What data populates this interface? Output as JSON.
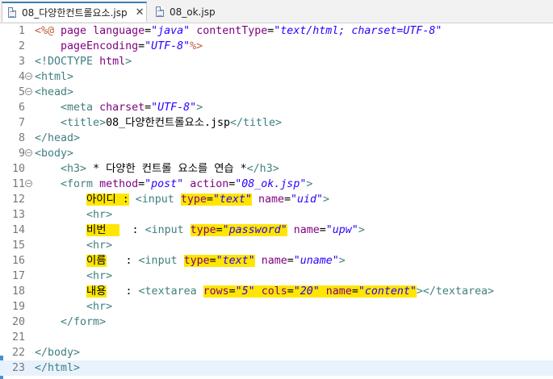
{
  "tabs": [
    {
      "label": "08_다양한컨트롤요소.jsp",
      "close": "✕"
    },
    {
      "label": "08_ok.jsp"
    }
  ],
  "lines": [
    {
      "n": "1",
      "segs": [
        [
          "d",
          "<%@ "
        ],
        [
          "a",
          "page "
        ],
        [
          "a",
          "language"
        ],
        [
          "x",
          "="
        ],
        [
          "v",
          "\"java\""
        ],
        [
          "x",
          " "
        ],
        [
          "a",
          "contentType"
        ],
        [
          "x",
          "="
        ],
        [
          "v",
          "\"text/html; charset=UTF-8\""
        ]
      ]
    },
    {
      "n": "2",
      "segs": [
        [
          "x",
          "    "
        ],
        [
          "a",
          "pageEncoding"
        ],
        [
          "x",
          "="
        ],
        [
          "v",
          "\"UTF-8\""
        ],
        [
          "d",
          "%>"
        ]
      ]
    },
    {
      "n": "3",
      "segs": [
        [
          "t",
          "<!DOCTYPE "
        ],
        [
          "a",
          "html"
        ],
        [
          "t",
          ">"
        ]
      ]
    },
    {
      "n": "4",
      "fold": "−",
      "segs": [
        [
          "t",
          "<html>"
        ]
      ]
    },
    {
      "n": "5",
      "fold": "−",
      "segs": [
        [
          "t",
          "<head>"
        ]
      ]
    },
    {
      "n": "6",
      "segs": [
        [
          "x",
          "    "
        ],
        [
          "t",
          "<meta "
        ],
        [
          "a",
          "charset"
        ],
        [
          "x",
          "="
        ],
        [
          "v",
          "\"UTF-8\""
        ],
        [
          "t",
          ">"
        ]
      ]
    },
    {
      "n": "7",
      "segs": [
        [
          "x",
          "    "
        ],
        [
          "t",
          "<title>"
        ],
        [
          "x",
          "08_다양한컨트롤요소.jsp"
        ],
        [
          "t",
          "</title>"
        ]
      ]
    },
    {
      "n": "8",
      "segs": [
        [
          "t",
          "</head>"
        ]
      ]
    },
    {
      "n": "9",
      "fold": "−",
      "segs": [
        [
          "t",
          "<body>"
        ]
      ]
    },
    {
      "n": "10",
      "segs": [
        [
          "x",
          "    "
        ],
        [
          "t",
          "<h3>"
        ],
        [
          "x",
          " * 다양한 컨트롤 요소를 연습 *"
        ],
        [
          "t",
          "</h3>"
        ]
      ]
    },
    {
      "n": "11",
      "fold": "−",
      "segs": [
        [
          "x",
          "    "
        ],
        [
          "t",
          "<form "
        ],
        [
          "a",
          "method"
        ],
        [
          "x",
          "="
        ],
        [
          "v",
          "\"post\""
        ],
        [
          "x",
          " "
        ],
        [
          "a",
          "action"
        ],
        [
          "x",
          "="
        ],
        [
          "v",
          "\"08_ok.jsp\""
        ],
        [
          "t",
          ">"
        ]
      ]
    },
    {
      "n": "12",
      "segs": [
        [
          "x",
          "        "
        ],
        [
          "xh",
          "아이디 :"
        ],
        [
          "x",
          " "
        ],
        [
          "t",
          "<input "
        ],
        [
          "ah",
          "type"
        ],
        [
          "xh",
          "="
        ],
        [
          "vh",
          "\"text\""
        ],
        [
          "x",
          " "
        ],
        [
          "a",
          "name"
        ],
        [
          "x",
          "="
        ],
        [
          "v",
          "\"uid\""
        ],
        [
          "t",
          ">"
        ]
      ]
    },
    {
      "n": "13",
      "segs": [
        [
          "x",
          "        "
        ],
        [
          "t",
          "<hr>"
        ]
      ]
    },
    {
      "n": "14",
      "segs": [
        [
          "x",
          "        "
        ],
        [
          "xh",
          "비번  "
        ],
        [
          "x",
          "  : "
        ],
        [
          "t",
          "<input "
        ],
        [
          "ah",
          "type"
        ],
        [
          "xh",
          "="
        ],
        [
          "vh",
          "\"password\""
        ],
        [
          "x",
          " "
        ],
        [
          "a",
          "name"
        ],
        [
          "x",
          "="
        ],
        [
          "v",
          "\"upw\""
        ],
        [
          "t",
          ">"
        ]
      ]
    },
    {
      "n": "15",
      "segs": [
        [
          "x",
          "        "
        ],
        [
          "t",
          "<hr>"
        ]
      ]
    },
    {
      "n": "16",
      "segs": [
        [
          "x",
          "        "
        ],
        [
          "xh",
          "이름"
        ],
        [
          "x",
          "   : "
        ],
        [
          "t",
          "<input "
        ],
        [
          "ah",
          "type"
        ],
        [
          "xh",
          "="
        ],
        [
          "vh",
          "\"text\""
        ],
        [
          "x",
          " "
        ],
        [
          "a",
          "name"
        ],
        [
          "x",
          "="
        ],
        [
          "v",
          "\"uname\""
        ],
        [
          "t",
          ">"
        ]
      ]
    },
    {
      "n": "17",
      "segs": [
        [
          "x",
          "        "
        ],
        [
          "t",
          "<hr>"
        ]
      ]
    },
    {
      "n": "18",
      "segs": [
        [
          "x",
          "        "
        ],
        [
          "xh",
          "내용"
        ],
        [
          "x",
          "   : "
        ],
        [
          "t",
          "<textarea "
        ],
        [
          "ah",
          "rows"
        ],
        [
          "xh",
          "="
        ],
        [
          "vh",
          "\"5\""
        ],
        [
          "xh",
          " "
        ],
        [
          "ah",
          "cols"
        ],
        [
          "xh",
          "="
        ],
        [
          "vh",
          "\"20\""
        ],
        [
          "xh",
          " "
        ],
        [
          "ah",
          "name"
        ],
        [
          "xh",
          "="
        ],
        [
          "vh",
          "\"content\""
        ],
        [
          "t",
          "></textarea>"
        ]
      ]
    },
    {
      "n": "19",
      "segs": [
        [
          "x",
          "        "
        ],
        [
          "t",
          "<hr>"
        ]
      ]
    },
    {
      "n": "20",
      "segs": [
        [
          "x",
          "    "
        ],
        [
          "t",
          "</form>"
        ]
      ]
    },
    {
      "n": "21",
      "segs": []
    },
    {
      "n": "22",
      "segs": [
        [
          "t",
          "</body>"
        ]
      ]
    },
    {
      "n": "23",
      "segs": [
        [
          "t",
          "</html>"
        ]
      ]
    }
  ]
}
